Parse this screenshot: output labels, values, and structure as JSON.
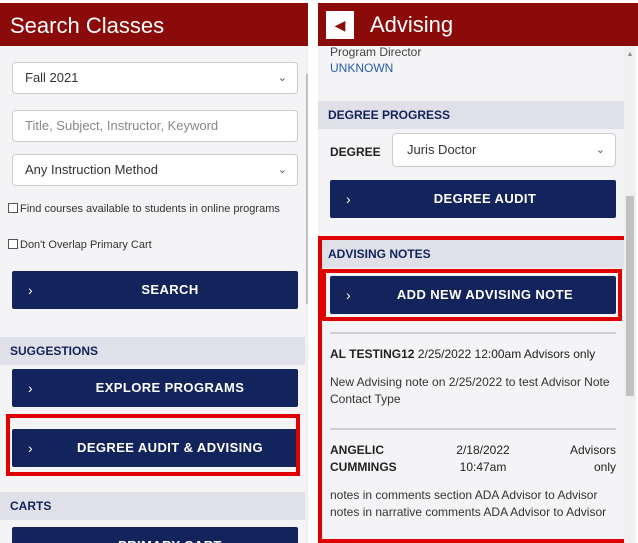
{
  "left": {
    "title": "Search Classes",
    "term_select": "Fall 2021",
    "search_placeholder": "Title, Subject, Instructor, Keyword",
    "method_select": "Any Instruction Method",
    "online_checkbox": "Find courses available to students in online programs",
    "overlap_checkbox": "Don't Overlap Primary Cart",
    "search_button": "SEARCH",
    "suggestions_header": "SUGGESTIONS",
    "explore_button": "EXPLORE PROGRAMS",
    "degree_audit_button": "DEGREE AUDIT & ADVISING",
    "carts_header": "CARTS",
    "primary_cart_button": "PRIMARY CART"
  },
  "right": {
    "title": "Advising",
    "program_director_label": "Program Director",
    "program_director_value": "UNKNOWN",
    "degree_progress_header": "DEGREE PROGRESS",
    "degree_label": "DEGREE",
    "degree_select": "Juris Doctor",
    "degree_audit_button": "DEGREE AUDIT",
    "advising_notes_header": "ADVISING NOTES",
    "add_note_button": "ADD NEW ADVISING NOTE",
    "notes": [
      {
        "author": "AL TESTING12",
        "date": "2/25/2022 12:00am",
        "visibility": "Advisors only",
        "body": "New Advising note on 2/25/2022 to test Advisor Note Contact Type"
      },
      {
        "author": "ANGELIC CUMMINGS",
        "date": "2/18/2022 10:47am",
        "visibility": "Advisors only",
        "body": "notes in comments section ADA Advisor to Advisor notes in narrative comments ADA Advisor to Advisor"
      }
    ]
  },
  "icons": {
    "chevron": "›",
    "dropdown": "⌄",
    "back": "◀"
  },
  "colors": {
    "header_red": "#8b0a0a",
    "navy": "#13235b",
    "highlight_red": "#e10000",
    "link_blue": "#2a5ea8"
  }
}
